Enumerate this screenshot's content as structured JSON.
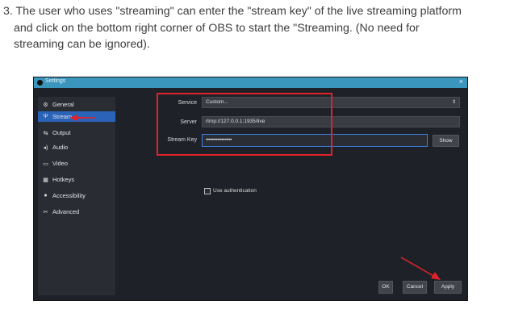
{
  "instructions": {
    "line1": "3. The user who uses \"streaming\" can enter the \"stream key\" of the live streaming platform",
    "line2": "and click on the bottom right corner of OBS to start the \"Streaming.  (No need for",
    "line3": "streaming can be ignored)."
  },
  "window": {
    "title": "Settings",
    "close_glyph": "×"
  },
  "sidebar": {
    "items": [
      {
        "label": "General",
        "icon": "gear-icon"
      },
      {
        "label": "Stream",
        "icon": "antenna-icon"
      },
      {
        "label": "Output",
        "icon": "output-icon"
      },
      {
        "label": "Audio",
        "icon": "speaker-icon"
      },
      {
        "label": "Video",
        "icon": "monitor-icon"
      },
      {
        "label": "Hotkeys",
        "icon": "keyboard-icon"
      },
      {
        "label": "Accessibility",
        "icon": "accessibility-icon"
      },
      {
        "label": "Advanced",
        "icon": "wrench-icon"
      }
    ],
    "active_index": 1
  },
  "stream": {
    "service_label": "Service",
    "service_value": "Custom...",
    "server_label": "Server",
    "server_value": "rtmp://127.0.0.1:1935/live",
    "key_label": "Stream Key",
    "key_value": "••••••••••••••••••",
    "show_button": "Show",
    "use_auth_label": "Use authentication"
  },
  "footer": {
    "ok": "OK",
    "cancel": "Cancel",
    "apply": "Apply"
  },
  "colors": {
    "accent": "#2a63b8",
    "titlebar": "#3a96bd",
    "highlight": "#e0232b"
  }
}
